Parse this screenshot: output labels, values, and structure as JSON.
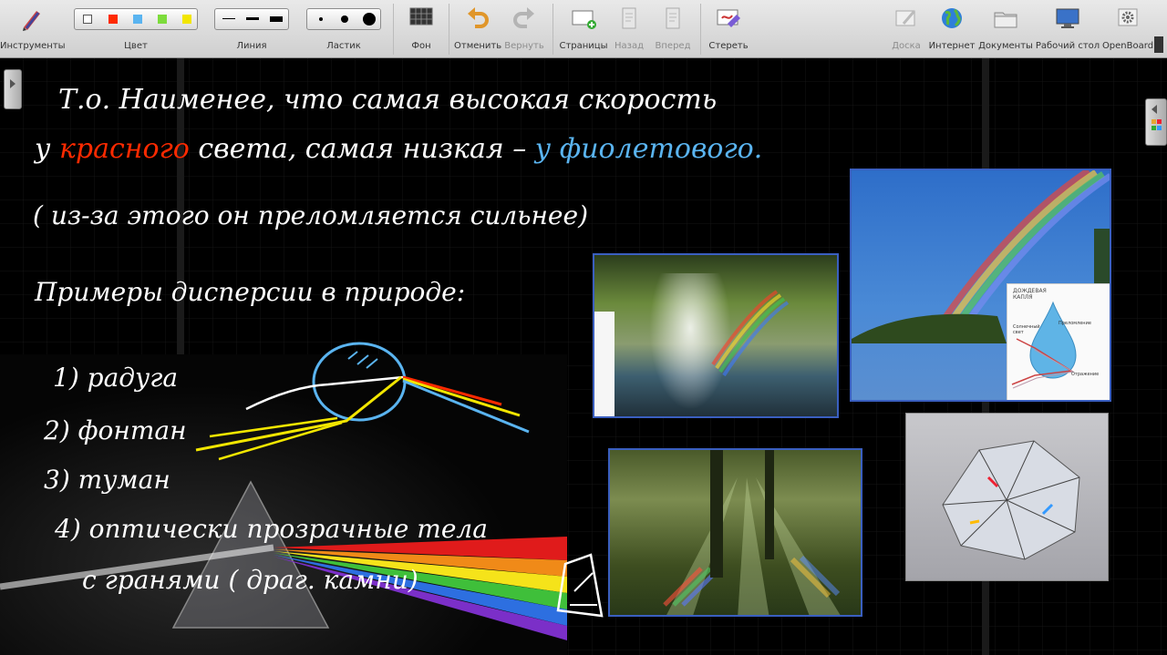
{
  "toolbar": {
    "tools": "Инструменты",
    "color": "Цвет",
    "line": "Линия",
    "eraser": "Ластик",
    "background": "Фон",
    "undo": "Отменить",
    "redo": "Вернуть",
    "pages": "Страницы",
    "back": "Назад",
    "forward": "Вперед",
    "erase": "Стереть",
    "board": "Доска",
    "internet": "Интернет",
    "documents": "Документы",
    "desktop": "Рабочий стол",
    "openboard": "OpenBoard"
  },
  "colors": [
    "#ffffff",
    "#ff2a00",
    "#5ab4f0",
    "#7ddc3c",
    "#f2e600"
  ],
  "board": {
    "line1": "Т.о. Наименее, что самая высокая скорость",
    "line2_a": "у ",
    "line2_red": "красного",
    "line2_b": " света, самая низкая – ",
    "line2_blue": "у фиолетового.",
    "line3": "( из-за этого он преломляется сильнее)",
    "line4": "Примеры дисперсии в природе:",
    "item1": "1) радуга",
    "item2": "2) фонтан",
    "item3": "3) туман",
    "item4": "4) оптически прозрачные тела",
    "item5": "с гранями ( драг. камни)"
  },
  "raindrop": {
    "caption": "ДОЖДЕВАЯ КАПЛЯ",
    "sunlight": "Солнечный свет",
    "refraction": "Преломление",
    "reflection": "Отражение"
  }
}
